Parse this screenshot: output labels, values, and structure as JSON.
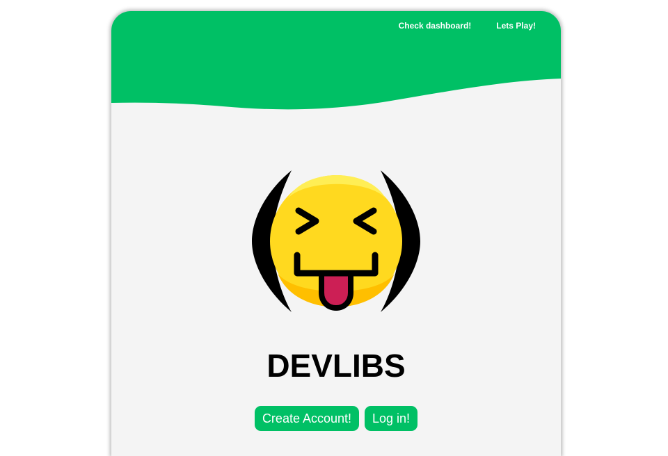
{
  "nav": {
    "dashboard_label": "Check dashboard!",
    "play_label": "Lets Play!"
  },
  "logo": {
    "icon": "tongue-out-squinting-emoji-icon"
  },
  "main": {
    "title": "DEVLIBS",
    "create_account_label": "Create Account!",
    "login_label": "Log in!"
  },
  "colors": {
    "brand_green": "#00c065",
    "page_background": "#f4f4f4",
    "emoji_yellow": "#ffd91f",
    "tongue": "#cc1f55"
  }
}
